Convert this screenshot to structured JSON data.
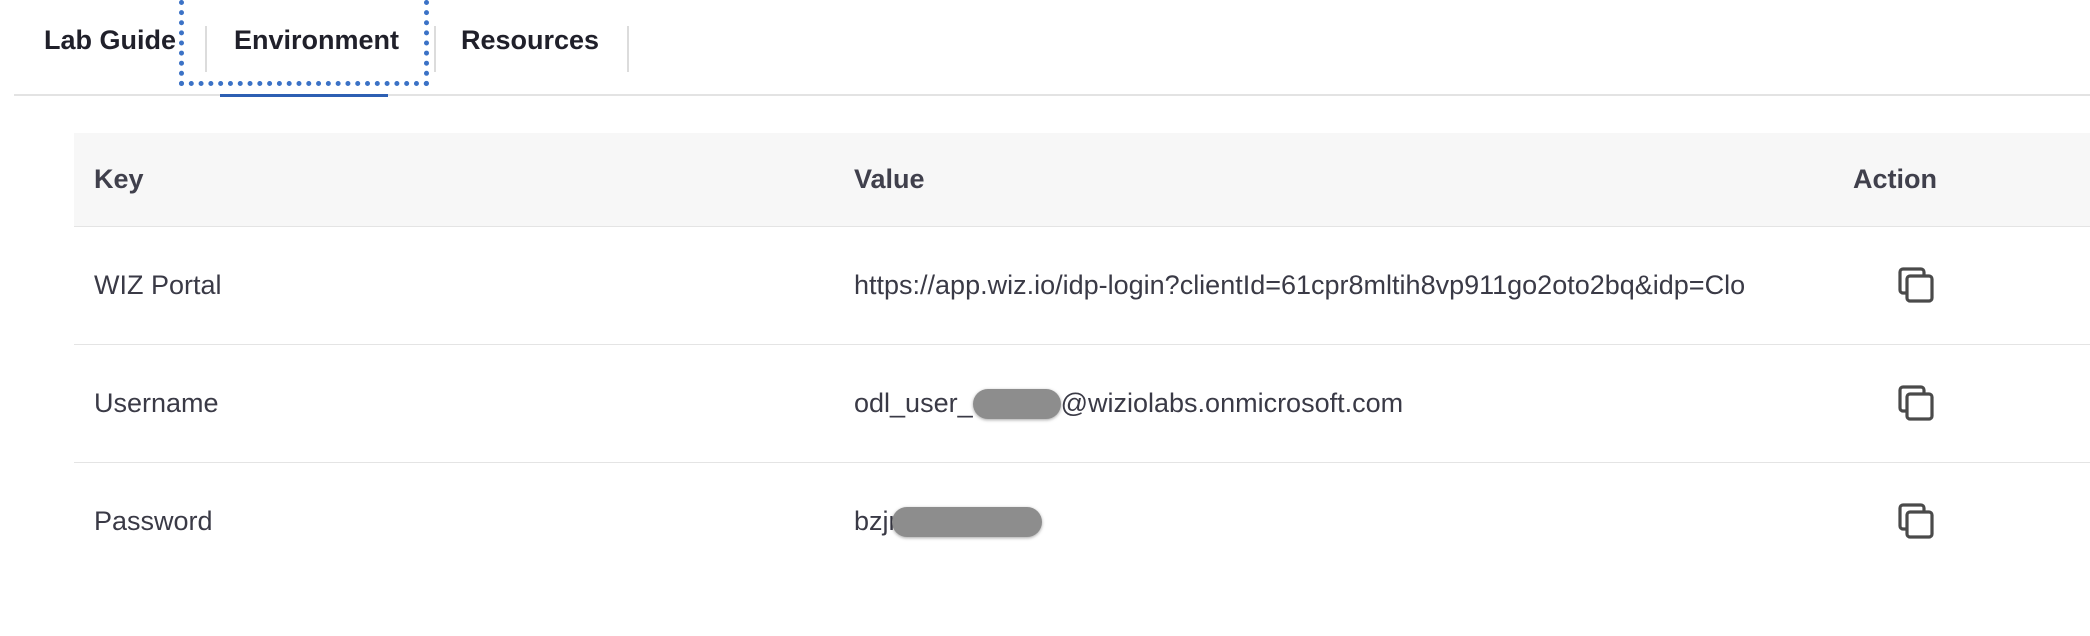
{
  "tabs": [
    {
      "label": "Lab Guide",
      "active": false
    },
    {
      "label": "Environment",
      "active": true
    },
    {
      "label": "Resources",
      "active": false
    }
  ],
  "table": {
    "headers": {
      "key": "Key",
      "value": "Value",
      "action": "Action"
    },
    "rows": [
      {
        "key": "WIZ Portal",
        "value_text": "https://app.wiz.io/idp-login?clientId=61cpr8mltih8vp911go2oto2bq&idp=Clo",
        "action_icon": "copy-icon"
      },
      {
        "key": "Username",
        "value_prefix": "odl_user_",
        "value_redacted": true,
        "value_suffix": "@wiziolabs.onmicrosoft.com",
        "action_icon": "copy-icon"
      },
      {
        "key": "Password",
        "value_prefix": "bzjr",
        "value_redacted": true,
        "action_icon": "copy-icon"
      }
    ]
  },
  "colors": {
    "focus_ring": "#3b72c6",
    "active_underline": "#2d5fb3",
    "header_bg": "#f7f7f7",
    "redaction": "#8d8d8d"
  }
}
